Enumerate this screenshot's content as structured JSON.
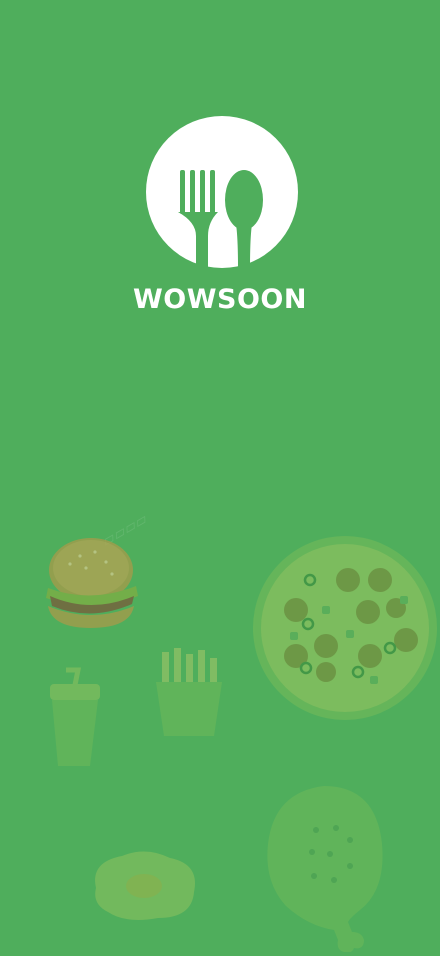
{
  "app": {
    "brand_name": "WOWSOON",
    "background_color": "#4fae5c",
    "logo_icon": "fork-spoon-icon"
  },
  "illustrations": [
    "burger-icon",
    "pizza-icon",
    "fries-icon",
    "drink-cup-icon",
    "fried-egg-icon",
    "chicken-leg-icon"
  ]
}
